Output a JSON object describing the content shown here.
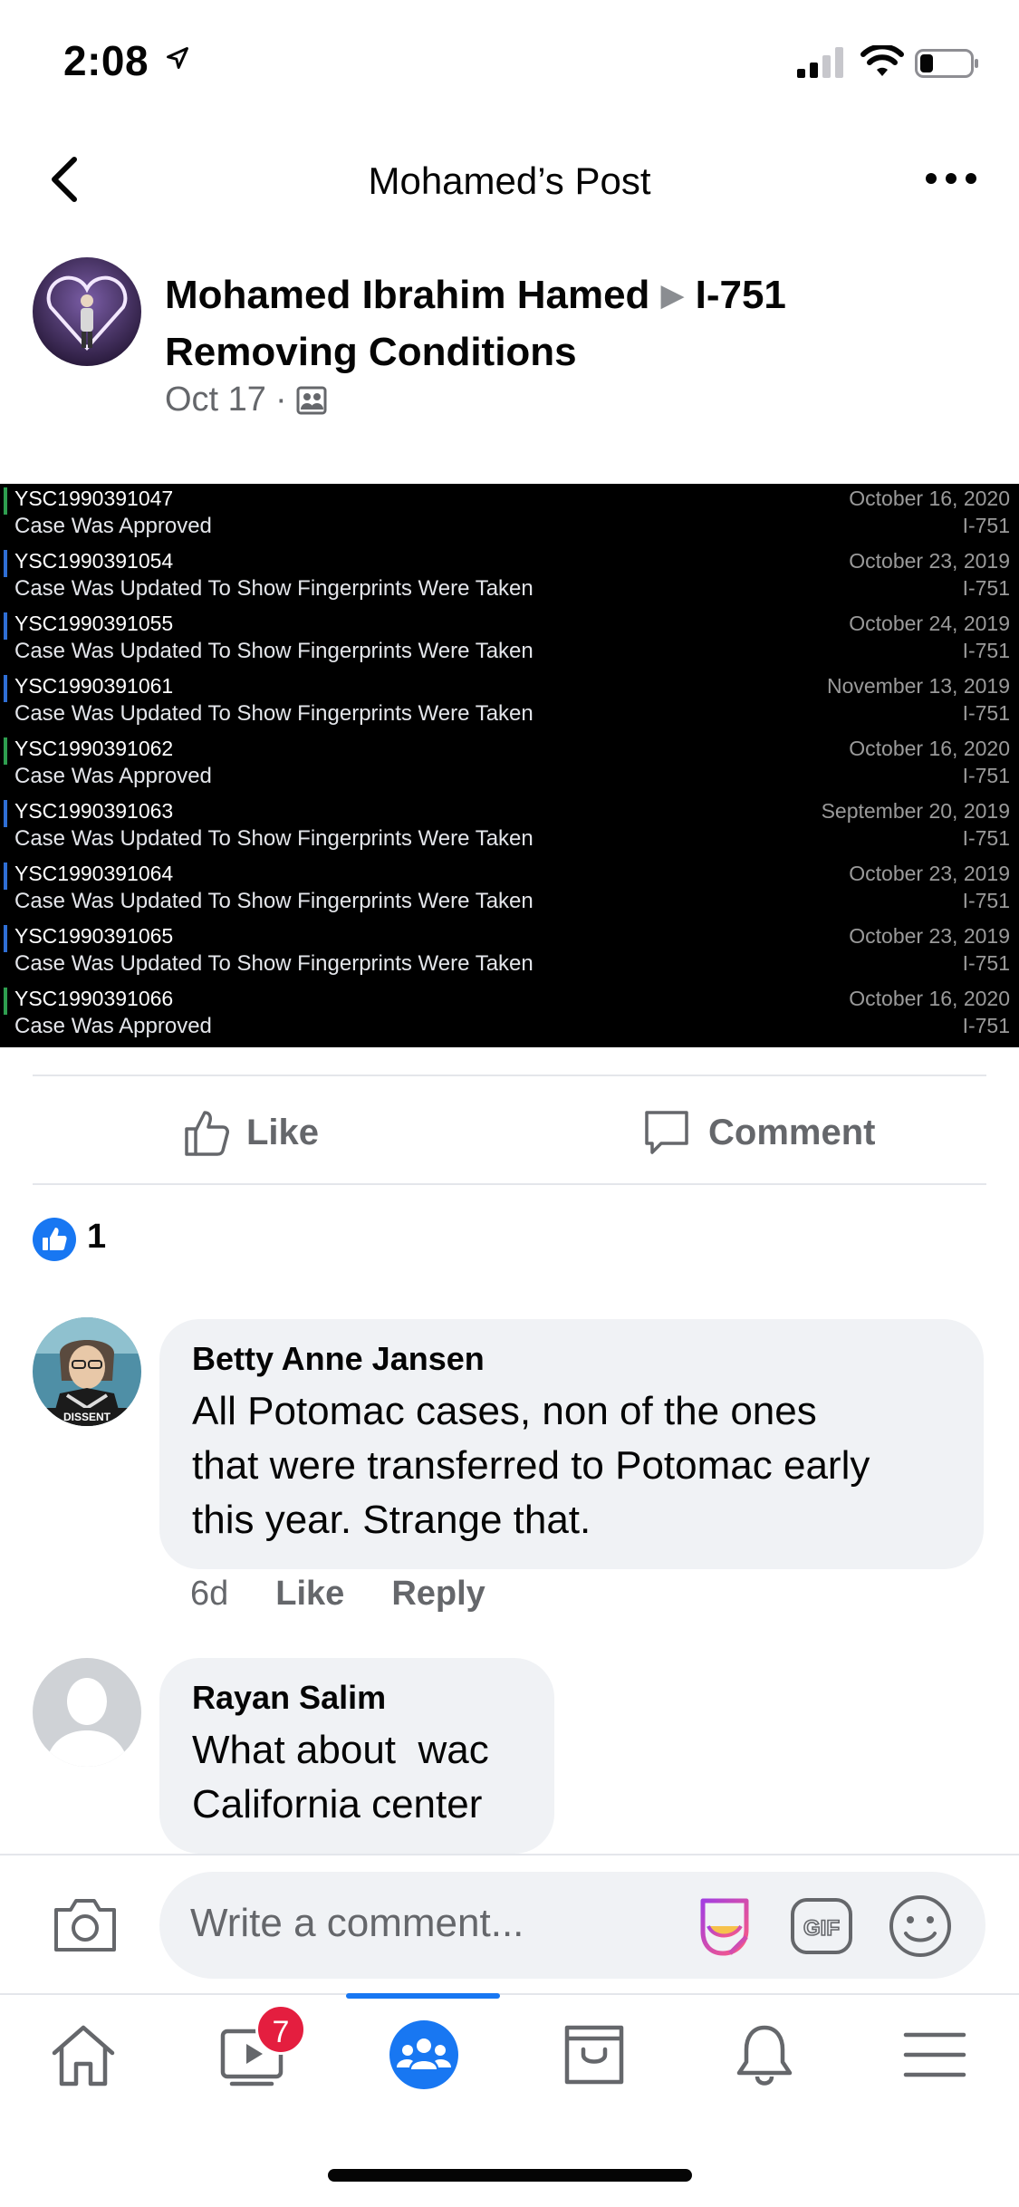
{
  "status_bar": {
    "time": "2:08"
  },
  "header": {
    "title": "Mohamed’s Post"
  },
  "post": {
    "author": "Mohamed Ibrahim Hamed",
    "group_line1": "I-751",
    "group_line2": "Removing Conditions",
    "date": "Oct 17",
    "separator": "·",
    "cases": [
      {
        "id": "YSC1990391047",
        "status": "Case Was Approved",
        "date": "October 16, 2020",
        "form": "I-751",
        "bar_color": "#2e9e4f"
      },
      {
        "id": "YSC1990391054",
        "status": "Case Was Updated To Show Fingerprints Were Taken",
        "date": "October 23, 2019",
        "form": "I-751",
        "bar_color": "#2f6fd6"
      },
      {
        "id": "YSC1990391055",
        "status": "Case Was Updated To Show Fingerprints Were Taken",
        "date": "October 24, 2019",
        "form": "I-751",
        "bar_color": "#2f6fd6"
      },
      {
        "id": "YSC1990391061",
        "status": "Case Was Updated To Show Fingerprints Were Taken",
        "date": "November 13, 2019",
        "form": "I-751",
        "bar_color": "#2f6fd6"
      },
      {
        "id": "YSC1990391062",
        "status": "Case Was Approved",
        "date": "October 16, 2020",
        "form": "I-751",
        "bar_color": "#2e9e4f"
      },
      {
        "id": "YSC1990391063",
        "status": "Case Was Updated To Show Fingerprints Were Taken",
        "date": "September 20, 2019",
        "form": "I-751",
        "bar_color": "#2f6fd6"
      },
      {
        "id": "YSC1990391064",
        "status": "Case Was Updated To Show Fingerprints Were Taken",
        "date": "October 23, 2019",
        "form": "I-751",
        "bar_color": "#2f6fd6"
      },
      {
        "id": "YSC1990391065",
        "status": "Case Was Updated To Show Fingerprints Were Taken",
        "date": "October 23, 2019",
        "form": "I-751",
        "bar_color": "#2f6fd6"
      },
      {
        "id": "YSC1990391066",
        "status": "Case Was Approved",
        "date": "October 16, 2020",
        "form": "I-751",
        "bar_color": "#2e9e4f"
      }
    ]
  },
  "actions": {
    "like": "Like",
    "comment": "Comment"
  },
  "reactions": {
    "count": "1"
  },
  "comments": [
    {
      "name": "Betty Anne Jansen",
      "text_lines": [
        "All Potomac cases, non of the ones",
        "that were transferred to Potomac early",
        "this year. Strange that."
      ],
      "time": "6d",
      "like": "Like",
      "reply": "Reply"
    },
    {
      "name": "Rayan Salim",
      "text_lines": [
        "What about  wac",
        "California center"
      ]
    }
  ],
  "composer": {
    "placeholder": "Write a comment...",
    "gif_label": "GIF"
  },
  "tabbar": {
    "video_badge": "7",
    "tabs": [
      {
        "name": "tab-home",
        "icon": "home-icon"
      },
      {
        "name": "tab-watch",
        "icon": "video-icon"
      },
      {
        "name": "tab-groups",
        "icon": "groups-icon"
      },
      {
        "name": "tab-marketplace",
        "icon": "marketplace-icon"
      },
      {
        "name": "tab-notifications",
        "icon": "bell-icon"
      },
      {
        "name": "tab-menu",
        "icon": "menu-icon"
      }
    ]
  },
  "colors": {
    "accent": "#1877f2",
    "badge": "#e41e3f",
    "muted": "#65676b",
    "bubble": "#f0f2f5"
  }
}
